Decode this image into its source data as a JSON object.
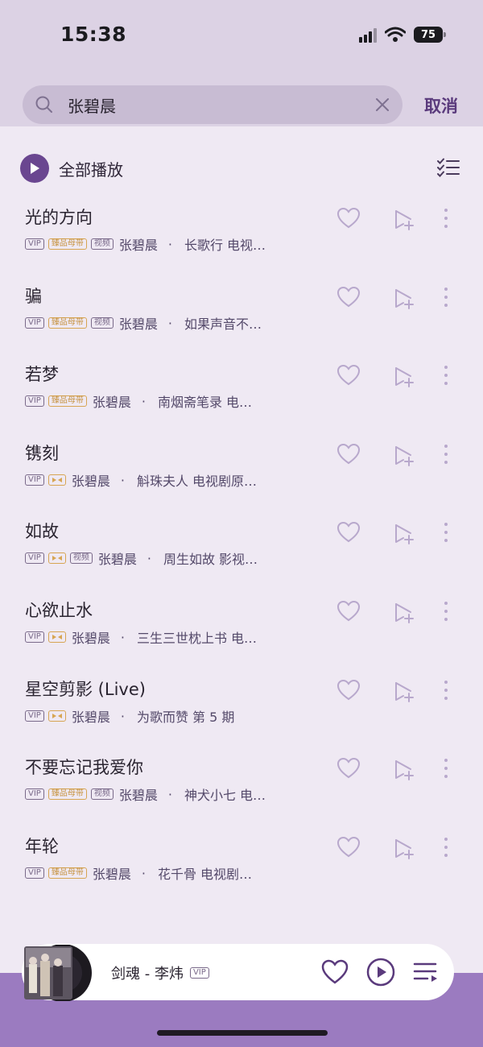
{
  "status_bar": {
    "time": "15:38",
    "battery": "75"
  },
  "search": {
    "query": "张碧晨",
    "cancel_label": "取消"
  },
  "toolbar": {
    "play_all_label": "全部播放"
  },
  "icons": {
    "primary": "#6a4690",
    "heart": "heart-outline-icon",
    "add_to_queue": "add-to-queue-icon",
    "more": "more-vertical-icon"
  },
  "songs": [
    {
      "title": "光的方向",
      "tags": [
        "VIP",
        "臻品母带",
        "视频"
      ],
      "artist": "张碧晨",
      "sep": "·",
      "desc": "长歌行 电视…"
    },
    {
      "title": "骗",
      "tags": [
        "VIP",
        "臻品母带",
        "视频"
      ],
      "artist": "张碧晨",
      "sep": "·",
      "desc": "如果声音不…"
    },
    {
      "title": "若梦",
      "tags": [
        "VIP",
        "臻品母带"
      ],
      "artist": "张碧晨",
      "sep": "·",
      "desc": "南烟斋笔录 电…"
    },
    {
      "title": "镌刻",
      "tags": [
        "VIP",
        "dolby"
      ],
      "artist": "张碧晨",
      "sep": "·",
      "desc": "斛珠夫人 电视剧原…"
    },
    {
      "title": "如故",
      "tags": [
        "VIP",
        "dolby",
        "视频"
      ],
      "artist": "张碧晨",
      "sep": "·",
      "desc": "周生如故 影视…"
    },
    {
      "title": "心欲止水",
      "tags": [
        "VIP",
        "dolby"
      ],
      "artist": "张碧晨",
      "sep": "·",
      "desc": "三生三世枕上书 电…"
    },
    {
      "title": "星空剪影 (Live)",
      "tags": [
        "VIP",
        "dolby"
      ],
      "artist": "张碧晨",
      "sep": "·",
      "desc": "为歌而赞 第 5 期"
    },
    {
      "title": "不要忘记我爱你",
      "tags": [
        "VIP",
        "臻品母带",
        "视频"
      ],
      "artist": "张碧晨",
      "sep": "·",
      "desc": "神犬小七 电…"
    },
    {
      "title": "年轮",
      "tags": [
        "VIP",
        "臻品母带"
      ],
      "artist": "张碧晨",
      "sep": "·",
      "desc": "花千骨 电视剧…"
    }
  ],
  "now_playing": {
    "title": "剑魂 - 李炜",
    "badge": "VIP"
  }
}
